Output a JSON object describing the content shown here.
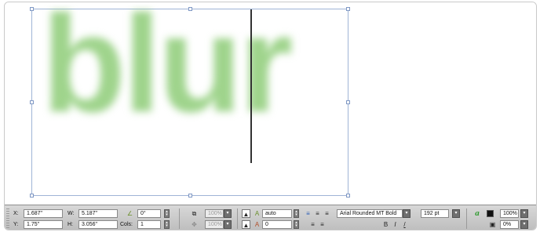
{
  "canvas": {
    "text": "blur",
    "text_color": "#9fd48c",
    "frame_color": "#9fb4d6"
  },
  "palette": {
    "x_label": "X:",
    "x_value": "1.687\"",
    "y_label": "Y:",
    "y_value": "1.75\"",
    "w_label": "W:",
    "w_value": "5.187\"",
    "h_label": "H:",
    "h_value": "3.056\"",
    "angle_value": "0°",
    "cols_label": "Cols:",
    "cols_value": "1",
    "scale_top": "100%",
    "scale_bottom": "100%",
    "leading_value": "auto",
    "kerning_value": "0",
    "font_name": "Arial Rounded MT Bold",
    "font_size": "192 pt",
    "opacity_value": "100%",
    "shade_value": "0%",
    "icons": {
      "angle": "angle-icon",
      "picture_scale": "picture-scale-icon",
      "picture_offset": "picture-offset-icon",
      "leading": "leading-icon",
      "kerning": "kerning-icon",
      "align_left": "align-left-icon",
      "align_center": "align-center-icon",
      "align_right": "align-right-icon",
      "text_style": "text-style-icon",
      "character_color": "character-color-icon",
      "fill_color": "fill-color-icon"
    },
    "accent_green": "#2e9a2e"
  }
}
